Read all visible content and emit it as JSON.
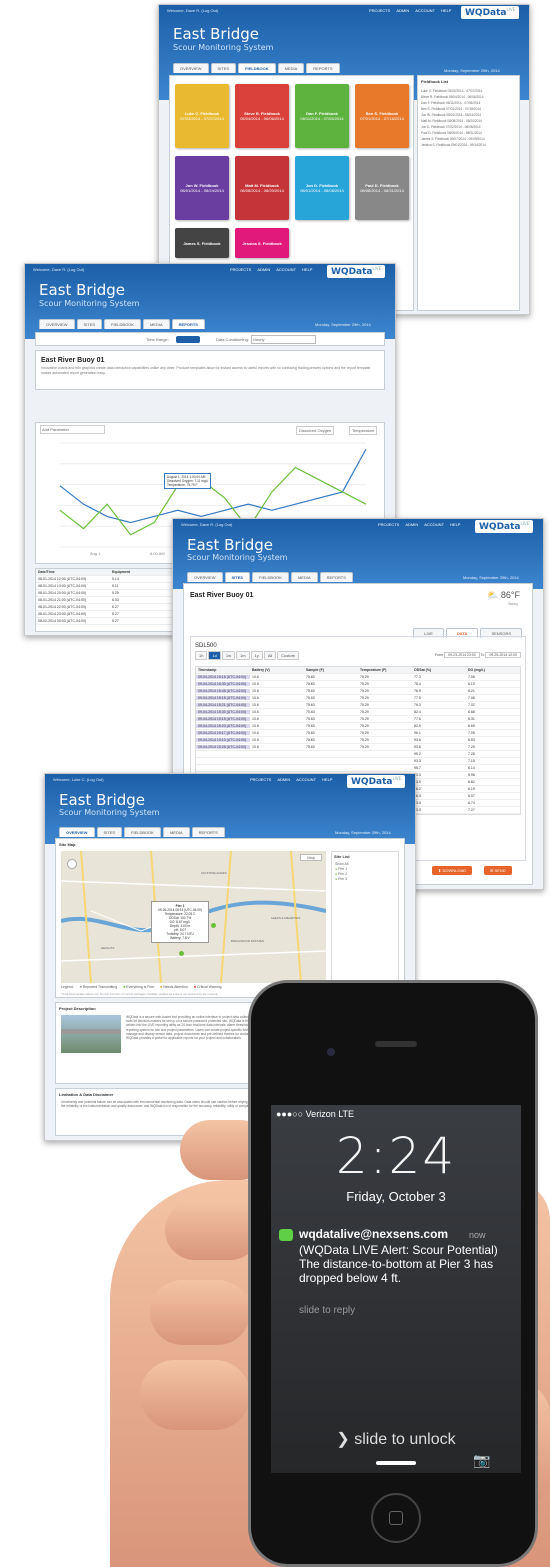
{
  "brand": {
    "title": "East Bridge",
    "subtitle": "Scour Monitoring System",
    "logo": "WQData",
    "logo_sup": "LIVE"
  },
  "nav": {
    "projects": "PROJECTS",
    "admin": "ADMIN",
    "account": "ACCOUNT",
    "help": "HELP"
  },
  "tabs": {
    "overview": "OVERVIEW",
    "sites": "SITES",
    "fieldbook": "FIELDBOOK",
    "media": "MEDIA",
    "reports": "REPORTS"
  },
  "screen1": {
    "welcome": "Welcome, Dave R. (Log Out)",
    "date": "Monday, September 29th, 2014",
    "fieldbooks": [
      {
        "name": "Luke C. Fieldbook",
        "dates": "07/03/2014 - 07/07/2014",
        "color": "#e9b930"
      },
      {
        "name": "Steve R. Fieldbook",
        "dates": "05/04/2014 - 06/06/2014",
        "color": "#d9413a"
      },
      {
        "name": "Dan F. Fieldbook",
        "dates": "06/11/2014 - 07/05/2014",
        "color": "#5db33e"
      },
      {
        "name": "Ben S. Fieldbook",
        "dates": "07/01/2014 - 07/18/2014",
        "color": "#e8782a"
      },
      {
        "name": "Jon W. Fieldbook",
        "dates": "08/01/2014 - 08/24/2014",
        "color": "#6a3ea0"
      },
      {
        "name": "Matt M. Fieldbook",
        "dates": "08/08/2014 - 08/20/2014",
        "color": "#c53438"
      },
      {
        "name": "Jon D. Fieldbook",
        "dates": "08/01/2014 - 08/08/2014",
        "color": "#27a4d8"
      },
      {
        "name": "Paul D. Fieldbook",
        "dates": "08/08/2014 - 08/31/2014",
        "color": "#888888"
      },
      {
        "name": "James S. Fieldbook",
        "dates": "",
        "color": "#444444"
      },
      {
        "name": "Jessica S. Fieldbook",
        "dates": "",
        "color": "#e0197a"
      }
    ],
    "list_title": "Fieldbook List",
    "list": [
      "Luke C. Fieldbook 03/02/2014 - 07/07/2014",
      "Steve R. Fieldbook 05/04/2014 - 06/06/2014",
      "Dan F. Fieldbook 06/11/2014 - 07/05/2014",
      "Ben S. Fieldbook 07/01/2014 - 07/18/2014",
      "Jon W. Fieldbook 08/01/2014 - 08/24/2014",
      "Matt M. Fieldbook 08/08/2014 - 08/20/2014",
      "Jon D. Fieldbook 07/02/2014 - 08/08/2014",
      "Paul D. Fieldbook 08/08/2014 - 08/31/2014",
      "James S. Fieldbook 09/07/2014 - 09/09/2014",
      "Jessica S. Fieldbook 09/01/2014 - 09/14/2014"
    ]
  },
  "screen2": {
    "welcome": "Welcome, Dave R. (Log Out)",
    "date": "Monday, September 29th, 2014",
    "time_range": "Time Range:",
    "data_conditioning": "Data Conditioning:",
    "conditioning_value": "Hourly",
    "heading": "East River Buoy 01",
    "body": "Innovative charts and info graphics create data interaction capabilities unlike any other. Produce templates allow for instant access to useful reports with no confusing trading presets options and the report template makes automated report generation easy.",
    "add_parameter": "Add Parameter",
    "legend1": "Dissolved Oxygen",
    "legend2": "Temperature",
    "tooltip": [
      "August 1, 2014 1:00:00 AM",
      "Dissolved Oxygen: 7.11 mg/L",
      "Temperature: 75.79 F"
    ],
    "table_head": [
      "Date/Time",
      "Equipment"
    ],
    "table_rows": [
      [
        "08-01-2014 12:00 (UTC-04:00)",
        "5.14"
      ],
      [
        "08-01-2014 13:00 (UTC-04:00)",
        "5.11"
      ],
      [
        "08-01-2014 20:00 (UTC-04:00)",
        "5.25"
      ],
      [
        "08-01-2014 21:00 (UTC-04:00)",
        "6.03"
      ],
      [
        "08-01-2014 22:00 (UTC-04:00)",
        "6.27"
      ],
      [
        "08-01-2014 23:00 (UTC-04:00)",
        "5.27"
      ],
      [
        "08-02-2014 00:00 (UTC-04:00)",
        "5.27"
      ]
    ]
  },
  "chart_data": {
    "type": "line",
    "series": [
      {
        "name": "Dissolved Oxygen",
        "color": "#3579c4",
        "values": [
          75.9,
          75.6,
          75.4,
          75.3,
          75.4,
          75.5,
          75.4,
          75.5,
          75.6,
          75.5,
          75.6,
          75.7,
          75.8,
          76.5
        ]
      },
      {
        "name": "Temperature",
        "color": "#6cbf3a",
        "values": [
          75.5,
          75.2,
          75.6,
          75.1,
          75.3,
          75.9,
          76.0,
          75.7,
          75.2,
          75.8,
          76.2,
          76.0,
          75.8,
          75.6
        ]
      }
    ],
    "ylim": [
      74.9,
      76.6
    ],
    "x_ticks": [
      "Aug 1",
      "8:00 AM",
      "4:00 PM"
    ]
  },
  "screen3": {
    "welcome": "Welcome, Dave R. (Log Out)",
    "date": "Monday, September 29th, 2014",
    "heading": "East River Buoy 01",
    "weather": "86°F",
    "weather_sub": "Sunny",
    "subtabs": [
      "LIVE",
      "DATA",
      "SENSORS"
    ],
    "sensor": "SDL500",
    "ranges": [
      "1h",
      "1d",
      "1w",
      "1m",
      "1y",
      "All",
      "Custom"
    ],
    "from_label": "From",
    "from": "09-23-2014 23:00",
    "to_label": "To",
    "to": "09-25-2014 12:00",
    "headers": [
      "Timestamp",
      "Battery (V)",
      "Sample (F)",
      "Temperature (F)",
      "ODSat (%)",
      "DO (mg/L)"
    ],
    "rows": [
      [
        "09-04-2014 15:15 (UTC-04:00)",
        "10.6",
        "75.63",
        "75.29",
        "77.3",
        "7.06"
      ],
      [
        "09-04-2014 15:30 (UTC-04:00)",
        "10.6",
        "75.63",
        "75.29",
        "78.4",
        "6.10"
      ],
      [
        "09-04-2014 15:45 (UTC-04:00)",
        "10.6",
        "75.63",
        "75.29",
        "76.9",
        "6.21"
      ],
      [
        "09-04-2014 15:15 (UTC-04:00)",
        "10.6",
        "75.63",
        "75.29",
        "77.5",
        "7.06"
      ],
      [
        "09-04-2014 15:21 (UTC-04:00)",
        "10.6",
        "75.63",
        "75.29",
        "76.3",
        "7.02"
      ],
      [
        "09-04-2014 15:30 (UTC-04:00)",
        "10.6",
        "75.63",
        "75.29",
        "82.4",
        "6.66"
      ],
      [
        "09-04-2014 15:15 (UTC-04:00)",
        "10.6",
        "75.63",
        "75.29",
        "77.6",
        "6.31"
      ],
      [
        "09-04-2014 15:20 (UTC-04:00)",
        "10.6",
        "75.63",
        "75.29",
        "82.9",
        "6.69"
      ],
      [
        "09-04-2014 15:17 (UTC-04:00)",
        "10.6",
        "75.63",
        "75.29",
        "96.1",
        "7.05"
      ],
      [
        "09-04-2014 15:10 (UTC-04:00)",
        "10.6",
        "75.63",
        "75.29",
        "93.6",
        "6.53"
      ],
      [
        "09-04-2014 15:25 (UTC-04:00)",
        "10.6",
        "75.63",
        "75.29",
        "93.8",
        "7.29"
      ]
    ],
    "extra_odsat": [
      "95.2",
      "93.3",
      "95.7",
      "73.3",
      "83.0",
      "76.2",
      "96.3",
      "73.4",
      "73.3"
    ],
    "extra_do": [
      "7.28",
      "7.15",
      "6.14",
      "5.96",
      "6.82",
      "6.19",
      "6.07",
      "6.74",
      "7.27"
    ],
    "download": "DOWNLOAD",
    "send": "SEND"
  },
  "screen4": {
    "welcome": "Welcome, Luke C. (Log Out)",
    "date": "Monday, September 29th, 2014",
    "map_title": "Site Map",
    "map_type": "Map",
    "site_list_title": "Site List",
    "site_list": [
      "Show All",
      "Pier 1",
      "Pier 2",
      "Pier 3"
    ],
    "popup": [
      "Pier 1",
      "09-26-2014 08:14 (UTC-04:00)",
      "Temperature: 22.05 C",
      "ODSat: 100.7%",
      "DO: 8.67 mg/L",
      "Depth: 3.03 m",
      "pH: 8.07",
      "Turbidity: 24.7 NTU",
      "Battery: 7.8 V"
    ],
    "map_labels": [
      "BIRCHWOOD ESTATES",
      "KOUNTRE ACRES",
      "LEEDS & MEADOWS",
      "HEIGHTS"
    ],
    "legend_label": "Legend:",
    "legend": [
      "Reported Transmitting",
      "Everything is Fine",
      "Needs Attention",
      "Critical Warning"
    ],
    "legend_colors": [
      "#9aa6b2",
      "#6cbf3a",
      "#e3b52c",
      "#d23a3a"
    ],
    "legend_note": "*Total listed update status over the last 24 hours of current packages. Partially updated as a site is not received by the network.",
    "desc_title": "Project Description",
    "desc": "WQData is a secure web-based tool providing an online interface to project data collection, set using any web browser. Specifically designed for environmental monitoring applications, these tools let decision-makers be set up on a secure password protected site. WQData is the live portion of the NexSens WQData and provides data in the field in virtually any project. Data is written into the LIVE reporting utility as 24-hour real-time data intervals, alarm thresholds and the custom notifications. Alarms provide real-time notifications via email to text with an online data reporting system for site and project parameters. Users can create project-specific folders to share data and site information within the project. The site provides a complete set of tools to manage and display sensor data, project documents and pre-defined themes for custom use and logs. ",
    "desc_more": "Select sensor data templates to define hourly, daily, and monthly measurements. WQData provides a portal for applicable reports for your project and collaborators.",
    "disclaimer_title": "Limitation & Data Disclaimer",
    "disclaimer": "Uncertainty and potential failure can be associated with environmental monitoring data. Data users should use caution before relying on for decisions that concern personal or public safety or the conduct of business. Data quality is limited by the reliability of the instrumentation and quality assurance, and WQData is not responsible for the accuracy, reliability, utility or completeness of the information provided. Use of the data described as information provided on these pages."
  },
  "phone": {
    "carrier": "●●●○○ Verizon",
    "network": "LTE",
    "time": "2:24",
    "date": "Friday, October 3",
    "sender": "wqdatalive@nexsens.com",
    "when": "now",
    "message": "(WQData LIVE Alert: Scour Potential)\nThe distance-to-bottom at Pier 3 has dropped below 4 ft.",
    "reply": "slide to reply",
    "unlock": "slide to unlock"
  }
}
